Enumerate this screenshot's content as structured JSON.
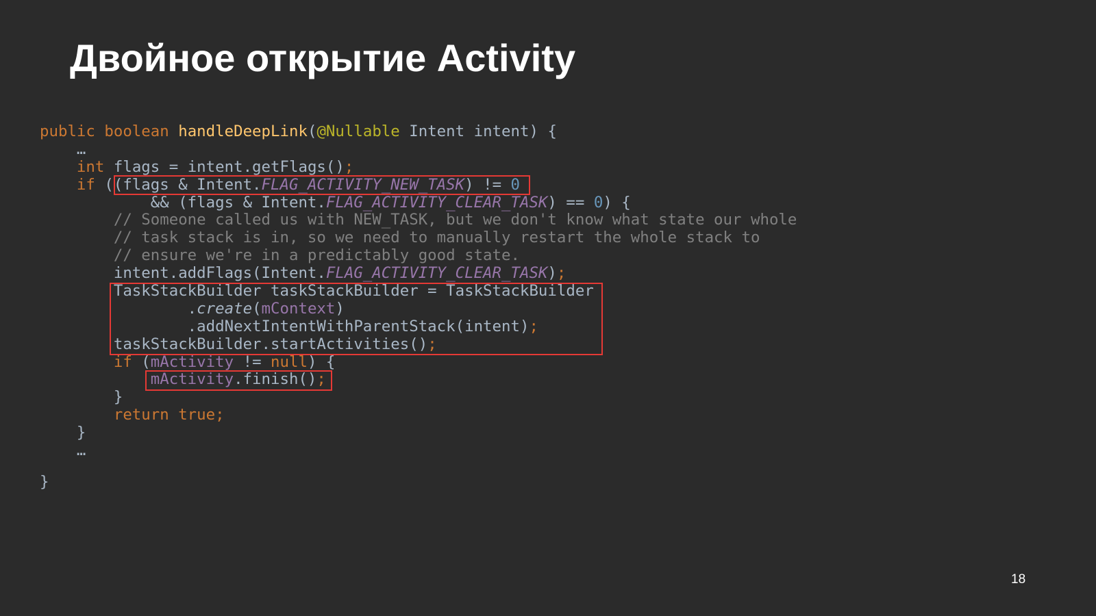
{
  "slide": {
    "title": "Двойное открытие Activity",
    "page_number": "18"
  },
  "code": {
    "l1": {
      "a": "public boolean ",
      "b": "handleDeepLink",
      "c": "(",
      "d": "@Nullable",
      "e": " Intent intent) {"
    },
    "l2": {
      "a": "    …"
    },
    "l3": {
      "a": "    ",
      "b": "int",
      "c": " flags = intent.getFlags()",
      "d": ";"
    },
    "l4": {
      "a": "    ",
      "b": "if",
      "c": " ((flags & Intent.",
      "d": "FLAG_ACTIVITY_NEW_TASK",
      "e": ") != ",
      "f": "0"
    },
    "l5": {
      "a": "            && (flags & Intent.",
      "b": "FLAG_ACTIVITY_CLEAR_TASK",
      "c": ") == ",
      "d": "0",
      "e": ") {"
    },
    "l6": {
      "a": "        // Someone called us with NEW_TASK, but we don't know what state our whole"
    },
    "l7": {
      "a": "        // task stack is in, so we need to manually restart the whole stack to"
    },
    "l8": {
      "a": "        // ensure we're in a predictably good state."
    },
    "l9": {
      "a": "        intent.addFlags(Intent.",
      "b": "FLAG_ACTIVITY_CLEAR_TASK",
      "c": ")",
      "d": ";"
    },
    "l10": {
      "a": "        TaskStackBuilder taskStackBuilder = TaskStackBuilder"
    },
    "l11": {
      "a": "                .",
      "b": "create",
      "c": "(",
      "d": "mContext",
      "e": ")"
    },
    "l12": {
      "a": "                .addNextIntentWithParentStack(intent)",
      "b": ";"
    },
    "l13": {
      "a": "        taskStackBuilder.startActivities()",
      "b": ";"
    },
    "l14": {
      "a": "        ",
      "b": "if",
      "c": " (",
      "d": "mActivity",
      "e": " != ",
      "f": "null",
      "g": ") {"
    },
    "l15": {
      "a": "            ",
      "b": "mActivity",
      "c": ".finish()",
      "d": ";"
    },
    "l16": {
      "a": "        }"
    },
    "l17": {
      "a": "        ",
      "b": "return true",
      "c": ";"
    },
    "l18": {
      "a": "    }"
    },
    "l19": {
      "a": "    …"
    },
    "l20": {
      "a": "}"
    }
  },
  "colors": {
    "background": "#2b2b2b",
    "keyword": "#cc7832",
    "method": "#ffc66d",
    "annotation": "#bbb529",
    "field": "#9876aa",
    "number": "#6897bb",
    "comment": "#808080",
    "default_text": "#a9b7c6",
    "highlight_box": "#e53935"
  }
}
